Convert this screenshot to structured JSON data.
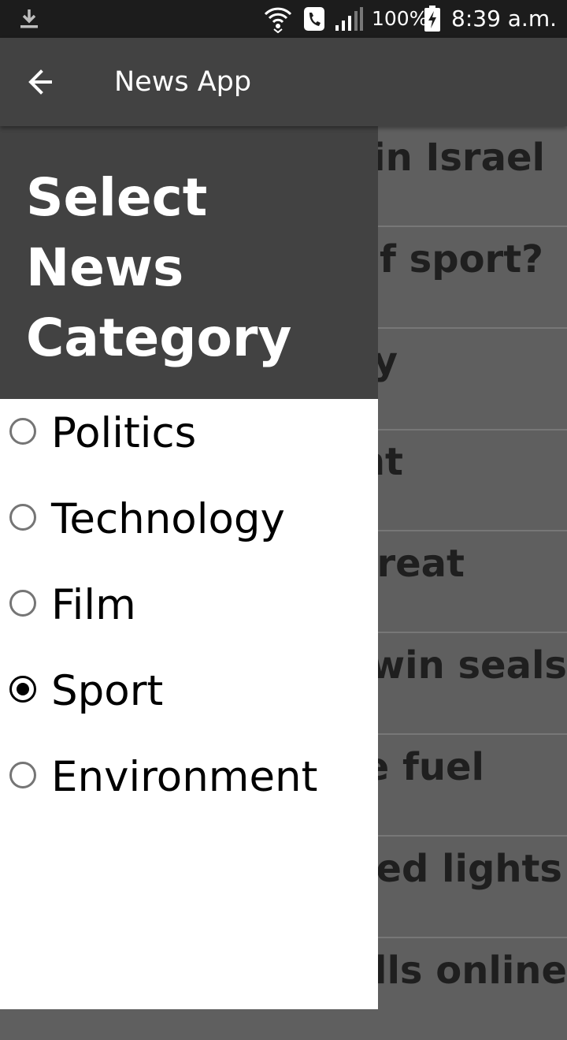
{
  "status_bar": {
    "battery_percent": "100%",
    "time": "8:39 a.m.",
    "icons": [
      "download-icon",
      "wifi-icon",
      "phone-call-icon",
      "signal-icon",
      "battery-charging-icon"
    ]
  },
  "app_bar": {
    "title": "News App",
    "back_icon": "arrow-left-icon"
  },
  "drawer": {
    "heading": "Select News Category",
    "options": [
      {
        "label": "Politics",
        "selected": false
      },
      {
        "label": "Technology",
        "selected": false
      },
      {
        "label": "Film",
        "selected": false
      },
      {
        "label": "Sport",
        "selected": true
      },
      {
        "label": "Environment",
        "selected": false
      }
    ]
  },
  "news_list": {
    "items": [
      "in Israel",
      "of sport?",
      "y",
      "nt",
      "great",
      "win seals",
      "e fuel",
      "red lights",
      "ells online"
    ]
  },
  "colors": {
    "status_bar": "#1c1c1c",
    "app_bar": "#424242",
    "drawer_header": "#424242",
    "drawer_body": "#ffffff",
    "list_overlay": "#5f5f5f"
  }
}
